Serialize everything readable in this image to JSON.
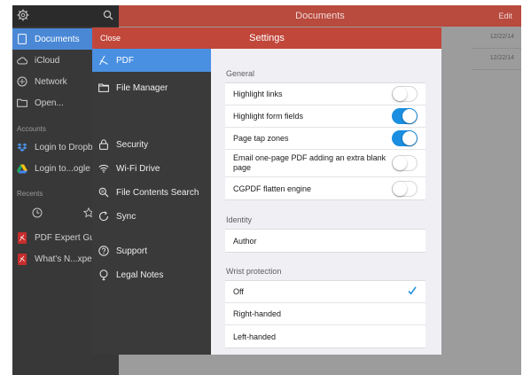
{
  "background": {
    "title": "Documents",
    "edit_label": "Edit",
    "sidebar": {
      "items": [
        {
          "label": "Documents",
          "icon": "document-icon",
          "active": true
        },
        {
          "label": "iCloud",
          "icon": "cloud-icon"
        },
        {
          "label": "Network",
          "icon": "network-icon"
        },
        {
          "label": "Open...",
          "icon": "folder-icon"
        }
      ],
      "accounts_header": "Accounts",
      "accounts": [
        {
          "label": "Login to Dropbox",
          "icon": "dropbox-icon"
        },
        {
          "label": "Login to...ogle Dr",
          "icon": "google-drive-icon"
        }
      ],
      "recents_header": "Recents",
      "recents": [
        {
          "label": "PDF Expert Guide",
          "icon": "pdf-file-icon"
        },
        {
          "label": "What's N...xpert",
          "icon": "pdf-file-icon"
        }
      ]
    },
    "dates": [
      "12/22/14",
      "12/22/14"
    ]
  },
  "modal": {
    "close_label": "Close",
    "title": "Settings",
    "menu": [
      {
        "label": "PDF",
        "icon": "pdf-icon",
        "active": true
      },
      {
        "label": "File Manager",
        "icon": "folder-icon"
      },
      {
        "label": "Security",
        "icon": "lock-icon"
      },
      {
        "label": "Wi-Fi Drive",
        "icon": "wifi-icon"
      },
      {
        "label": "File Contents Search",
        "icon": "search-icon"
      },
      {
        "label": "Sync",
        "icon": "sync-icon"
      },
      {
        "label": "Support",
        "icon": "help-icon"
      },
      {
        "label": "Legal Notes",
        "icon": "info-icon"
      }
    ],
    "general": {
      "header": "General",
      "rows": [
        {
          "label": "Highlight links",
          "on": false
        },
        {
          "label": "Highlight form fields",
          "on": true
        },
        {
          "label": "Page tap zones",
          "on": true
        },
        {
          "label": "Email one-page PDF adding an extra blank page",
          "on": false
        },
        {
          "label": "CGPDF flatten engine",
          "on": false
        }
      ]
    },
    "identity": {
      "header": "Identity",
      "author_label": "Author"
    },
    "wrist": {
      "header": "Wrist protection",
      "options": [
        {
          "label": "Off",
          "selected": true
        },
        {
          "label": "Right-handed",
          "selected": false
        },
        {
          "label": "Left-handed",
          "selected": false
        }
      ]
    }
  },
  "colors": {
    "accent": "#4a90e2",
    "toggle_on": "#1a8ee0",
    "header_red": "#c1473b"
  }
}
